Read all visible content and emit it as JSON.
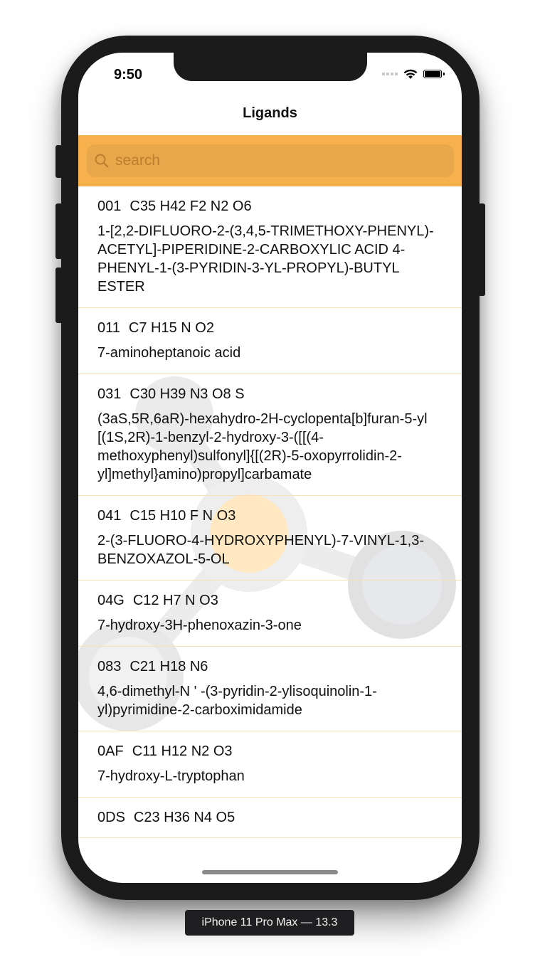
{
  "status_bar": {
    "time": "9:50"
  },
  "nav": {
    "title": "Ligands"
  },
  "search": {
    "placeholder": "search",
    "value": ""
  },
  "ligands": [
    {
      "id": "001",
      "formula": "C35 H42 F2 N2 O6",
      "name": "1-[2,2-DIFLUORO-2-(3,4,5-TRIMETHOXY-PHENYL)-ACETYL]-PIPERIDINE-2-CARBOXYLIC ACID 4-PHENYL-1-(3-PYRIDIN-3-YL-PROPYL)-BUTYL ESTER"
    },
    {
      "id": "011",
      "formula": "C7 H15 N O2",
      "name": "7-aminoheptanoic acid"
    },
    {
      "id": "031",
      "formula": "C30 H39 N3 O8 S",
      "name": "(3aS,5R,6aR)-hexahydro-2H-cyclopenta[b]furan-5-yl [(1S,2R)-1-benzyl-2-hydroxy-3-([[(4-methoxyphenyl)sulfonyl]{[(2R)-5-oxopyrrolidin-2-yl]methyl}amino)propyl]carbamate"
    },
    {
      "id": "041",
      "formula": "C15 H10 F N O3",
      "name": "2-(3-FLUORO-4-HYDROXYPHENYL)-7-VINYL-1,3-BENZOXAZOL-5-OL"
    },
    {
      "id": "04G",
      "formula": "C12 H7 N O3",
      "name": "7-hydroxy-3H-phenoxazin-3-one"
    },
    {
      "id": "083",
      "formula": "C21 H18 N6",
      "name": "4,6-dimethyl-N ' -(3-pyridin-2-ylisoquinolin-1-yl)pyrimidine-2-carboximidamide"
    },
    {
      "id": "0AF",
      "formula": "C11 H12 N2 O3",
      "name": "7-hydroxy-L-tryptophan"
    },
    {
      "id": "0DS",
      "formula": "C23 H36 N4 O5",
      "name": ""
    }
  ],
  "device_label": "iPhone 11 Pro Max — 13.3",
  "colors": {
    "accent": "#f6b14c",
    "search_field": "#e9a74b",
    "separator": "#f7dfb9"
  },
  "icons": {
    "search": "search-icon",
    "wifi": "wifi-icon",
    "battery": "battery-icon",
    "signal": "cellular-signal-icon"
  }
}
